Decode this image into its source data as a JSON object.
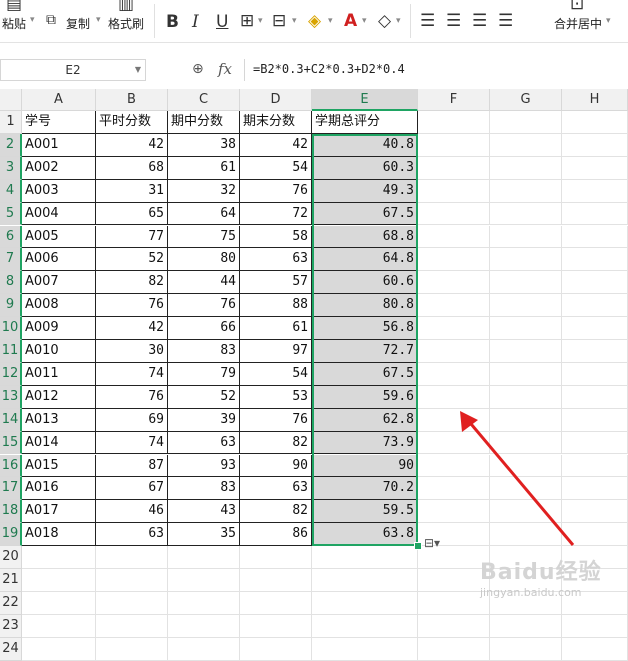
{
  "ribbon": {
    "paste_label": "粘贴",
    "copy_label": "复制",
    "format_painter_label": "格式刷",
    "merge_center_label": "合并居中"
  },
  "formula_bar": {
    "name_box": "E2",
    "fx_label": "fx",
    "formula": "=B2*0.3+C2*0.3+D2*0.4"
  },
  "columns": [
    "A",
    "B",
    "C",
    "D",
    "E",
    "F",
    "G",
    "H"
  ],
  "rows": [
    "1",
    "2",
    "3",
    "4",
    "5",
    "6",
    "7",
    "8",
    "9",
    "10",
    "11",
    "12",
    "13",
    "14",
    "15",
    "16",
    "17",
    "18",
    "19",
    "20",
    "21",
    "22",
    "23",
    "24"
  ],
  "headers": [
    "学号",
    "平时分数",
    "期中分数",
    "期末分数",
    "学期总评分"
  ],
  "data": [
    [
      "A001",
      "42",
      "38",
      "42",
      "40.8"
    ],
    [
      "A002",
      "68",
      "61",
      "54",
      "60.3"
    ],
    [
      "A003",
      "31",
      "32",
      "76",
      "49.3"
    ],
    [
      "A004",
      "65",
      "64",
      "72",
      "67.5"
    ],
    [
      "A005",
      "77",
      "75",
      "58",
      "68.8"
    ],
    [
      "A006",
      "52",
      "80",
      "63",
      "64.8"
    ],
    [
      "A007",
      "82",
      "44",
      "57",
      "60.6"
    ],
    [
      "A008",
      "76",
      "76",
      "88",
      "80.8"
    ],
    [
      "A009",
      "42",
      "66",
      "61",
      "56.8"
    ],
    [
      "A010",
      "30",
      "83",
      "97",
      "72.7"
    ],
    [
      "A011",
      "74",
      "79",
      "54",
      "67.5"
    ],
    [
      "A012",
      "76",
      "52",
      "53",
      "59.6"
    ],
    [
      "A013",
      "69",
      "39",
      "76",
      "62.8"
    ],
    [
      "A014",
      "74",
      "63",
      "82",
      "73.9"
    ],
    [
      "A015",
      "87",
      "93",
      "90",
      "90"
    ],
    [
      "A016",
      "67",
      "83",
      "63",
      "70.2"
    ],
    [
      "A017",
      "46",
      "43",
      "82",
      "59.5"
    ],
    [
      "A018",
      "63",
      "35",
      "86",
      "63.8"
    ]
  ],
  "watermark": "Baidu经验",
  "watermark_sub": "jingyan.baidu.com",
  "colors": {
    "selection": "#1fa463",
    "arrow": "#e02020",
    "selected_fill": "#d9d9d9"
  }
}
